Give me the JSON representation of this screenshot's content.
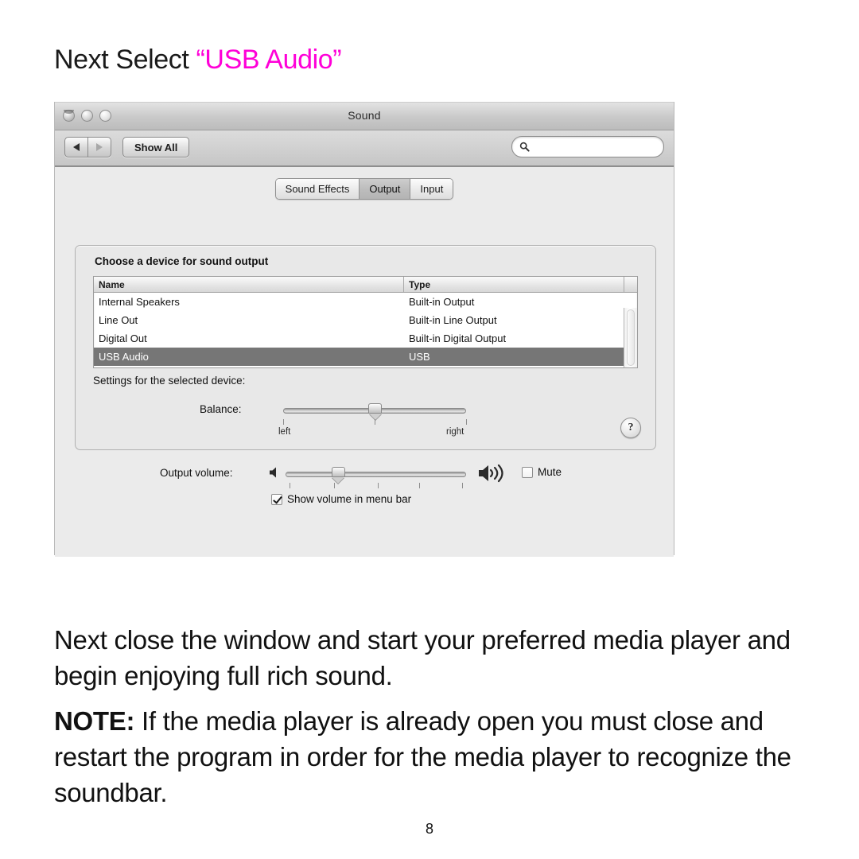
{
  "heading": {
    "prefix": "Next Select ",
    "accent": "“USB Audio”",
    "accent_color": "#ff00d8"
  },
  "window": {
    "title": "Sound",
    "traffic_lights": [
      "close-button",
      "minimize-button",
      "zoom-button"
    ],
    "toolbar": {
      "back_label": "",
      "forward_label": "",
      "show_all_label": "Show All",
      "search_placeholder": "",
      "search_value": ""
    },
    "tabs": [
      {
        "label": "Sound Effects",
        "active": false
      },
      {
        "label": "Output",
        "active": true
      },
      {
        "label": "Input",
        "active": false
      }
    ],
    "groupbox": {
      "label": "Choose a device for sound output",
      "table": {
        "columns": [
          "Name",
          "Type"
        ],
        "rows": [
          {
            "name": "Internal Speakers",
            "type": "Built-in Output",
            "selected": false
          },
          {
            "name": "Line Out",
            "type": "Built-in Line Output",
            "selected": false
          },
          {
            "name": "Digital Out",
            "type": "Built-in Digital Output",
            "selected": false
          },
          {
            "name": "USB Audio",
            "type": "USB",
            "selected": true
          }
        ],
        "selected_row_color": "#767676"
      },
      "settings_label": "Settings for the selected device:",
      "balance": {
        "label": "Balance:",
        "left_label": "left",
        "right_label": "right",
        "value_percent": 50,
        "tick_count": 3
      },
      "help_label": "?"
    },
    "output_volume": {
      "label": "Output volume:",
      "value_percent": 29,
      "tick_count": 5,
      "mute_label": "Mute",
      "mute_checked": false,
      "show_volume_label": "Show volume in menu bar",
      "show_volume_checked": true
    }
  },
  "body_copy": "Next close the window and start your preferred media player and begin enjoying full rich sound.",
  "note": {
    "tag": "NOTE:",
    "text": " If the media player is already open you must close and restart the program in order for the media player to recognize the soundbar."
  },
  "page_number": "8"
}
